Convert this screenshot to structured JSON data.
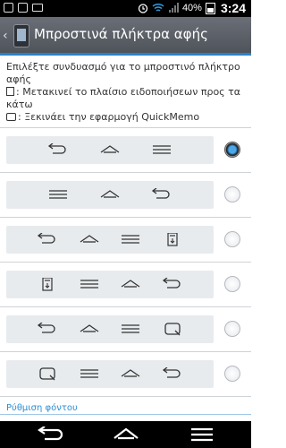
{
  "status_bar": {
    "battery": "40%",
    "time": "3:24",
    "left_icons": [
      "notification-icon",
      "checkbox-icon",
      "mail-icon"
    ],
    "right_icons": [
      "alarm-icon",
      "wifi-icon",
      "signal-icon",
      "battery-icon"
    ]
  },
  "header": {
    "title": "Μπροστινά πλήκτρα αφής"
  },
  "description": {
    "line1": "Επιλέξτε συνδυασμό για το μπροστινό πλήκτρο",
    "line2": "αφής",
    "notif_text": ": Μετακινεί το πλαίσιο ειδοποιήσεων προς τα",
    "notif_text_cont": "κάτω",
    "memo_text": ": Ξεκινάει την εφαρμογή QuickMemo"
  },
  "options": [
    {
      "buttons": [
        "back",
        "home",
        "menu"
      ],
      "selected": true
    },
    {
      "buttons": [
        "menu",
        "home",
        "back"
      ],
      "selected": false
    },
    {
      "buttons": [
        "back",
        "home",
        "menu",
        "notification"
      ],
      "selected": false
    },
    {
      "buttons": [
        "notification",
        "menu",
        "home",
        "back"
      ],
      "selected": false
    },
    {
      "buttons": [
        "back",
        "home",
        "menu",
        "quickmemo"
      ],
      "selected": false
    },
    {
      "buttons": [
        "quickmemo",
        "menu",
        "home",
        "back"
      ],
      "selected": false
    }
  ],
  "footer": {
    "section_label": "Ρύθμιση φόντου"
  },
  "nav_bar": {
    "buttons": [
      "back-icon",
      "home-icon",
      "menu-icon"
    ]
  }
}
